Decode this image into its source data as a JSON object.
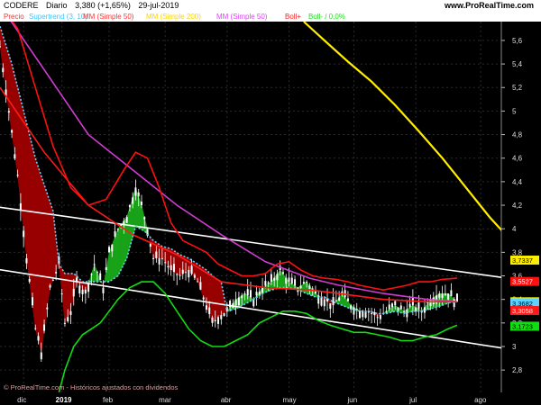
{
  "header": {
    "symbol": "CODERE",
    "period": "Diario",
    "quote": "3,380 (+1,65%)",
    "date": "29-jul-2019",
    "site": "www.ProRealTime.com"
  },
  "legend": [
    {
      "label": "Precio",
      "color": "#e53935"
    },
    {
      "label": "Supertrend (3, 10)",
      "color": "#40c4ff"
    },
    {
      "label": "MM (Simple 50)",
      "color": "#ff3333"
    },
    {
      "label": "MM (Simple 200)",
      "color": "#ffd400"
    },
    {
      "label": "MM (Simple 50)",
      "color": "#e040fb"
    },
    {
      "label": "Boll+",
      "color": "#ff2222"
    },
    {
      "label": "Boll- / 0,0%",
      "color": "#22dd22"
    }
  ],
  "watermark": "© ProRealTime.com - Históricos ajustados con dividendos",
  "colors": {
    "background": "#000000",
    "grid": "#2a2a2a",
    "up": "#19a319",
    "down": "#990000",
    "candle": "#ffffff",
    "channel": "#ffffff",
    "supertrend": "#5fd3ff",
    "sma_red": "#ff1a1a",
    "sma_yellow": "#ffee00",
    "sma_magenta": "#d23cd2",
    "boll_up": "#ff1010",
    "boll_down": "#11dd11"
  },
  "chart_data": {
    "type": "line",
    "title": "CODERE Diario",
    "xlabel": "",
    "ylabel": "",
    "ylim": [
      2.61,
      5.76
    ],
    "y_ticks": [
      "5,6",
      "5,4",
      "5,2",
      "5",
      "4,8",
      "4,6",
      "4,4",
      "4,2",
      "4",
      "3,8",
      "3,6",
      "3,4",
      "3,2",
      "3",
      "2,8"
    ],
    "y_tick_values": [
      5.6,
      5.4,
      5.2,
      5,
      4.8,
      4.6,
      4.4,
      4.2,
      4,
      3.8,
      3.6,
      3.4,
      3.2,
      3,
      2.8
    ],
    "x_ticks": [
      {
        "label": "dic",
        "index": 8
      },
      {
        "label": "2019",
        "index": 21
      },
      {
        "label": "feb",
        "index": 37
      },
      {
        "label": "mar",
        "index": 56
      },
      {
        "label": "abr",
        "index": 77
      },
      {
        "label": "may",
        "index": 98
      },
      {
        "label": "jun",
        "index": 120
      },
      {
        "label": "jul",
        "index": 141
      },
      {
        "label": "ago",
        "index": 163
      }
    ],
    "x_range": [
      0,
      170
    ],
    "price_close": [
      [
        0,
        5.55
      ],
      [
        3,
        5.0
      ],
      [
        6,
        4.45
      ],
      [
        9,
        3.75
      ],
      [
        12,
        3.15
      ],
      [
        14,
        2.95
      ],
      [
        17,
        3.5
      ],
      [
        20,
        3.7
      ],
      [
        22,
        3.2
      ],
      [
        24,
        3.3
      ],
      [
        26,
        3.55
      ],
      [
        29,
        3.45
      ],
      [
        32,
        3.7
      ],
      [
        35,
        3.5
      ],
      [
        37,
        3.8
      ],
      [
        40,
        4.0
      ],
      [
        43,
        4.1
      ],
      [
        46,
        4.35
      ],
      [
        48,
        4.2
      ],
      [
        50,
        4.0
      ],
      [
        52,
        3.75
      ],
      [
        55,
        3.75
      ],
      [
        58,
        3.65
      ],
      [
        61,
        3.6
      ],
      [
        64,
        3.65
      ],
      [
        67,
        3.55
      ],
      [
        70,
        3.35
      ],
      [
        72,
        3.2
      ],
      [
        74,
        3.25
      ],
      [
        77,
        3.3
      ],
      [
        80,
        3.4
      ],
      [
        83,
        3.45
      ],
      [
        86,
        3.4
      ],
      [
        89,
        3.5
      ],
      [
        92,
        3.55
      ],
      [
        95,
        3.65
      ],
      [
        98,
        3.55
      ],
      [
        101,
        3.5
      ],
      [
        104,
        3.55
      ],
      [
        107,
        3.45
      ],
      [
        110,
        3.4
      ],
      [
        113,
        3.35
      ],
      [
        116,
        3.45
      ],
      [
        119,
        3.35
      ],
      [
        122,
        3.3
      ],
      [
        125,
        3.3
      ],
      [
        128,
        3.25
      ],
      [
        131,
        3.3
      ],
      [
        134,
        3.35
      ],
      [
        137,
        3.3
      ],
      [
        140,
        3.35
      ],
      [
        143,
        3.3
      ],
      [
        146,
        3.4
      ],
      [
        149,
        3.45
      ],
      [
        152,
        3.45
      ],
      [
        155,
        3.38
      ]
    ],
    "series": [
      {
        "name": "Supertrend (3, 10)",
        "color": "#5fd3ff",
        "dashed": true,
        "points": [
          [
            0,
            5.72
          ],
          [
            4,
            5.4
          ],
          [
            8,
            5.0
          ],
          [
            12,
            4.6
          ],
          [
            16,
            4.3
          ],
          [
            18,
            4.15
          ],
          [
            20,
            3.7
          ],
          [
            22,
            3.62
          ],
          [
            25,
            3.62
          ],
          [
            28,
            3.55
          ],
          [
            31,
            3.55
          ],
          [
            34,
            3.55
          ],
          [
            37,
            3.55
          ],
          [
            40,
            3.6
          ],
          [
            43,
            3.75
          ],
          [
            46,
            4.02
          ],
          [
            49,
            3.98
          ],
          [
            52,
            3.9
          ],
          [
            55,
            3.85
          ],
          [
            58,
            3.83
          ],
          [
            61,
            3.78
          ],
          [
            64,
            3.75
          ],
          [
            67,
            3.7
          ],
          [
            70,
            3.65
          ],
          [
            73,
            3.58
          ],
          [
            75,
            3.55
          ],
          [
            77,
            3.3
          ],
          [
            80,
            3.32
          ],
          [
            83,
            3.36
          ],
          [
            86,
            3.4
          ],
          [
            89,
            3.45
          ],
          [
            92,
            3.48
          ],
          [
            95,
            3.5
          ],
          [
            98,
            3.5
          ],
          [
            101,
            3.48
          ],
          [
            104,
            3.45
          ],
          [
            107,
            3.42
          ],
          [
            110,
            3.42
          ],
          [
            113,
            3.38
          ],
          [
            116,
            3.35
          ],
          [
            119,
            3.32
          ],
          [
            122,
            3.3
          ],
          [
            125,
            3.3
          ],
          [
            128,
            3.28
          ],
          [
            131,
            3.28
          ],
          [
            134,
            3.3
          ],
          [
            137,
            3.28
          ],
          [
            140,
            3.3
          ],
          [
            143,
            3.3
          ],
          [
            146,
            3.32
          ],
          [
            149,
            3.34
          ],
          [
            152,
            3.37
          ],
          [
            155,
            3.38
          ]
        ]
      },
      {
        "name": "MM (Simple 200)",
        "color": "#ffee00",
        "points": [
          [
            103,
            5.76
          ],
          [
            110,
            5.6
          ],
          [
            118,
            5.42
          ],
          [
            126,
            5.25
          ],
          [
            134,
            5.05
          ],
          [
            142,
            4.83
          ],
          [
            150,
            4.6
          ],
          [
            158,
            4.35
          ],
          [
            166,
            4.1
          ],
          [
            174,
            3.88
          ],
          [
            181,
            3.72
          ]
        ]
      },
      {
        "name": "MM (Simple 50)",
        "color": "#d23cd2",
        "points": [
          [
            0,
            5.9
          ],
          [
            15,
            5.35
          ],
          [
            30,
            4.8
          ],
          [
            45,
            4.5
          ],
          [
            60,
            4.2
          ],
          [
            75,
            3.95
          ],
          [
            90,
            3.72
          ],
          [
            105,
            3.58
          ],
          [
            115,
            3.52
          ],
          [
            130,
            3.45
          ],
          [
            145,
            3.4
          ],
          [
            155,
            3.38
          ]
        ]
      },
      {
        "name": "MM (Simple 50)",
        "color": "#ff1a1a",
        "points": [
          [
            0,
            5.2
          ],
          [
            15,
            4.65
          ],
          [
            30,
            4.2
          ],
          [
            45,
            3.95
          ],
          [
            60,
            3.78
          ],
          [
            75,
            3.55
          ],
          [
            90,
            3.5
          ],
          [
            105,
            3.48
          ],
          [
            115,
            3.45
          ],
          [
            130,
            3.4
          ],
          [
            145,
            3.38
          ],
          [
            155,
            3.38
          ]
        ]
      },
      {
        "name": "Boll+",
        "color": "#ff1010",
        "points": [
          [
            0,
            5.9
          ],
          [
            6,
            5.7
          ],
          [
            12,
            5.2
          ],
          [
            18,
            4.7
          ],
          [
            24,
            4.35
          ],
          [
            30,
            4.2
          ],
          [
            36,
            4.25
          ],
          [
            42,
            4.5
          ],
          [
            46,
            4.65
          ],
          [
            50,
            4.6
          ],
          [
            54,
            4.35
          ],
          [
            58,
            4.05
          ],
          [
            62,
            3.9
          ],
          [
            66,
            3.85
          ],
          [
            70,
            3.8
          ],
          [
            74,
            3.7
          ],
          [
            78,
            3.65
          ],
          [
            82,
            3.6
          ],
          [
            86,
            3.6
          ],
          [
            90,
            3.62
          ],
          [
            94,
            3.7
          ],
          [
            98,
            3.72
          ],
          [
            102,
            3.65
          ],
          [
            106,
            3.6
          ],
          [
            110,
            3.58
          ],
          [
            114,
            3.57
          ],
          [
            118,
            3.55
          ],
          [
            122,
            3.52
          ],
          [
            126,
            3.5
          ],
          [
            130,
            3.48
          ],
          [
            134,
            3.5
          ],
          [
            138,
            3.52
          ],
          [
            142,
            3.55
          ],
          [
            146,
            3.55
          ],
          [
            150,
            3.57
          ],
          [
            155,
            3.58
          ]
        ]
      },
      {
        "name": "Boll-",
        "color": "#11dd11",
        "points": [
          [
            20,
            2.61
          ],
          [
            22,
            2.8
          ],
          [
            25,
            3.0
          ],
          [
            28,
            3.1
          ],
          [
            31,
            3.15
          ],
          [
            34,
            3.2
          ],
          [
            37,
            3.3
          ],
          [
            40,
            3.4
          ],
          [
            44,
            3.5
          ],
          [
            48,
            3.55
          ],
          [
            52,
            3.55
          ],
          [
            56,
            3.45
          ],
          [
            60,
            3.3
          ],
          [
            64,
            3.15
          ],
          [
            68,
            3.05
          ],
          [
            72,
            3.0
          ],
          [
            76,
            3.0
          ],
          [
            80,
            3.05
          ],
          [
            84,
            3.1
          ],
          [
            88,
            3.2
          ],
          [
            92,
            3.25
          ],
          [
            96,
            3.3
          ],
          [
            100,
            3.3
          ],
          [
            104,
            3.28
          ],
          [
            108,
            3.22
          ],
          [
            112,
            3.18
          ],
          [
            116,
            3.15
          ],
          [
            120,
            3.12
          ],
          [
            124,
            3.12
          ],
          [
            128,
            3.1
          ],
          [
            132,
            3.08
          ],
          [
            136,
            3.05
          ],
          [
            140,
            3.05
          ],
          [
            144,
            3.08
          ],
          [
            148,
            3.1
          ],
          [
            152,
            3.15
          ],
          [
            155,
            3.18
          ]
        ]
      }
    ],
    "channel_lines": [
      {
        "from": [
          -2,
          4.19
        ],
        "to": [
          172,
          3.58
        ]
      },
      {
        "from": [
          -2,
          3.66
        ],
        "to": [
          172,
          2.98
        ]
      }
    ],
    "value_labels": [
      {
        "text": "3,7337",
        "value": 3.7337,
        "bg": "#ffee00",
        "fg": "#000000"
      },
      {
        "text": "3,5527",
        "value": 3.5527,
        "bg": "#ff1010",
        "fg": "#ffffff"
      },
      {
        "text": "3,380",
        "value": 3.38,
        "bg": "#e6e600",
        "fg": "#000000"
      },
      {
        "text": "3,3682",
        "value": 3.3682,
        "bg": "#5fd3ff",
        "fg": "#000000"
      },
      {
        "text": "3,3058",
        "value": 3.3058,
        "bg": "#ff1a1a",
        "fg": "#ffffff"
      },
      {
        "text": "3,1723",
        "value": 3.1723,
        "bg": "#11dd11",
        "fg": "#000000"
      }
    ]
  }
}
